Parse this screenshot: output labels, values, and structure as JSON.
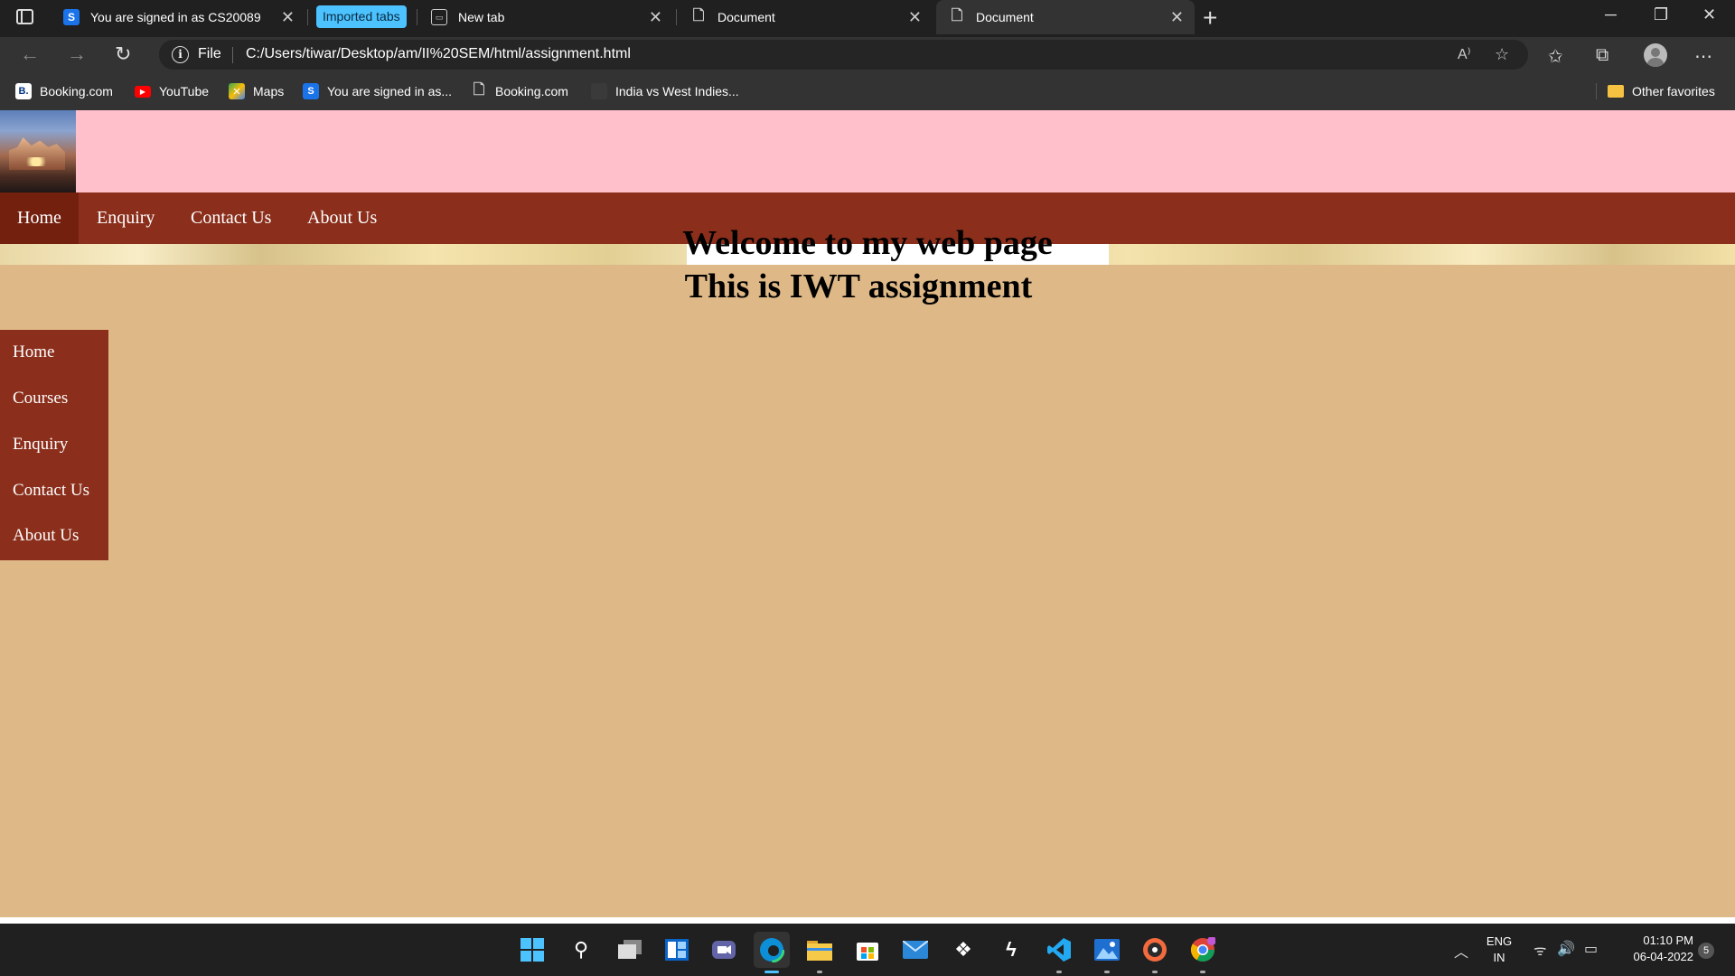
{
  "browser": {
    "tabs": [
      {
        "title": "You are signed in as CS20089",
        "icon": "s-logo-icon"
      },
      {
        "title": "New tab",
        "icon": "new-tab-icon"
      },
      {
        "title": "Document",
        "icon": "document-icon"
      },
      {
        "title": "Document",
        "icon": "document-icon",
        "active": true
      }
    ],
    "imported_tabs_label": "Imported tabs",
    "address": {
      "scheme_label": "File",
      "url": "C:/Users/tiwar/Desktop/am/II%20SEM/html/assignment.html"
    },
    "favorites": [
      {
        "label": "Booking.com",
        "icon": "booking-icon"
      },
      {
        "label": "YouTube",
        "icon": "youtube-icon"
      },
      {
        "label": "Maps",
        "icon": "maps-icon"
      },
      {
        "label": "You are signed in as...",
        "icon": "s-logo-icon"
      },
      {
        "label": "Booking.com",
        "icon": "document-icon"
      },
      {
        "label": "India vs West Indies...",
        "icon": "blank-icon"
      }
    ],
    "other_favorites_label": "Other favorites",
    "accent_color": "#4cc2ff"
  },
  "page": {
    "header_color": "#ffc0cb",
    "nav_color": "#8b2f1c",
    "background_color": "#deb887",
    "top_nav": [
      "Home",
      "Enquiry",
      "Contact Us",
      "About Us"
    ],
    "heading_line1": "Welcome to my web page",
    "heading_line2": "This is IWT assignment",
    "side_nav": [
      "Home",
      "Courses",
      "Enquiry",
      "Contact Us",
      "About Us"
    ]
  },
  "taskbar": {
    "language": "ENG",
    "region": "IN",
    "time": "01:10 PM",
    "date": "06-04-2022",
    "notification_count": "5"
  }
}
